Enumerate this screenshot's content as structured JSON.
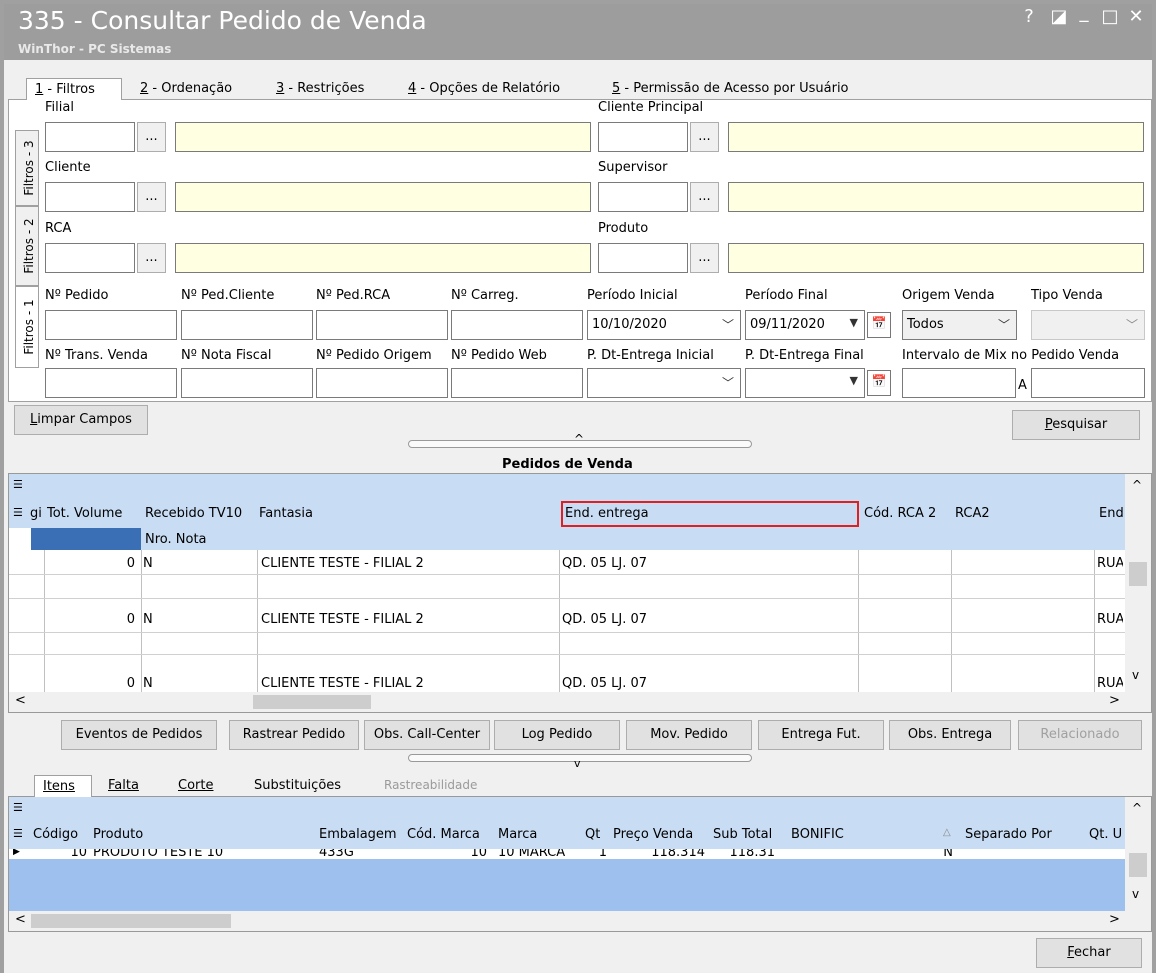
{
  "window": {
    "title": "335 - Consultar Pedido de Venda",
    "subtitle": "WinThor - PC Sistemas",
    "help": "?",
    "restore": "◪",
    "minimize": "_",
    "maximize": "□",
    "close": "✕"
  },
  "tabs": [
    {
      "key": "1",
      "label": " - Filtros"
    },
    {
      "key": "2",
      "label": " - Ordenação"
    },
    {
      "key": "3",
      "label": " - Restrições"
    },
    {
      "key": "4",
      "label": " - Opções de Relatório"
    },
    {
      "key": "5",
      "label": " - Permissão de Acesso por Usuário"
    }
  ],
  "vtabs": [
    "Filtros - 3",
    "Filtros - 2",
    "Filtros - 1"
  ],
  "filters": {
    "filial": "Filial",
    "cliente_principal": "Cliente Principal",
    "cliente": "Cliente",
    "supervisor": "Supervisor",
    "rca": "RCA",
    "produto": "Produto",
    "dots": "...",
    "n_pedido": "Nº Pedido",
    "n_ped_cliente": "Nº Ped.Cliente",
    "n_ped_rca": "Nº Ped.RCA",
    "n_carreg": "Nº Carreg.",
    "periodo_inicial": "Período Inicial",
    "periodo_final": "Período Final",
    "origem_venda": "Origem Venda",
    "tipo_venda": "Tipo Venda",
    "n_trans_venda": "Nº Trans. Venda",
    "n_nota_fiscal": "Nº Nota Fiscal",
    "n_pedido_origem": "Nº Pedido Origem",
    "n_pedido_web": "Nº Pedido Web",
    "p_dt_entrega_inicial": "P. Dt-Entrega Inicial",
    "p_dt_entrega_final": "P. Dt-Entrega Final",
    "intervalo_mix": "Intervalo de Mix no Pedido Venda",
    "a": "A",
    "periodo_inicial_value": "10/10/2020",
    "periodo_final_value": "09/11/2020",
    "origem_venda_value": "Todos"
  },
  "buttons": {
    "limpar": "Limpar Campos",
    "limpar_u": "L",
    "pesquisar": "Pesquisar",
    "pesquisar_u": "P",
    "fechar": "Fechar",
    "fechar_u": "F"
  },
  "pedidos": {
    "title": "Pedidos de  Venda",
    "headers": [
      "gi",
      "Tot. Volume",
      "Recebido TV10",
      "Fantasia",
      "End. entrega",
      "Cód. RCA 2",
      "RCA2",
      "End"
    ],
    "subheader": "Nro. Nota",
    "rows": [
      {
        "volume": "0",
        "recebido": "N",
        "fantasia": "CLIENTE TESTE - FILIAL 2",
        "end": "QD. 05 LJ. 07",
        "end2": "RUA"
      },
      {
        "volume": "0",
        "recebido": "N",
        "fantasia": "CLIENTE TESTE - FILIAL 2",
        "end": "QD. 05 LJ. 07",
        "end2": "RUA"
      },
      {
        "volume": "0",
        "recebido": "N",
        "fantasia": "CLIENTE TESTE - FILIAL 2",
        "end": "QD. 05 LJ. 07",
        "end2": "RUA"
      }
    ]
  },
  "actions": [
    "Eventos de Pedidos",
    "Rastrear Pedido",
    "Obs. Call-Center",
    "Log Pedido",
    "Mov. Pedido",
    "Entrega Fut.",
    "Obs. Entrega",
    "Relacionado"
  ],
  "itemtabs": [
    "Itens",
    "Falta",
    "Corte",
    "Substituições",
    "Rastreabilidade"
  ],
  "itens": {
    "headers": [
      "Código",
      "Produto",
      "Embalagem",
      "Cód. Marca",
      "Marca",
      "Qt",
      "Preço Venda",
      "Sub Total",
      "BONIFIC",
      "Separado Por",
      "Qt. U"
    ],
    "row": {
      "codigo": "10",
      "produto": "PRODUTO TESTE 10",
      "embalagem": "433G",
      "cod_marca": "10",
      "marca": "10 MARCA",
      "qt": "1",
      "preco": "118.314",
      "subtotal": "118.31",
      "bonific": "N"
    }
  }
}
